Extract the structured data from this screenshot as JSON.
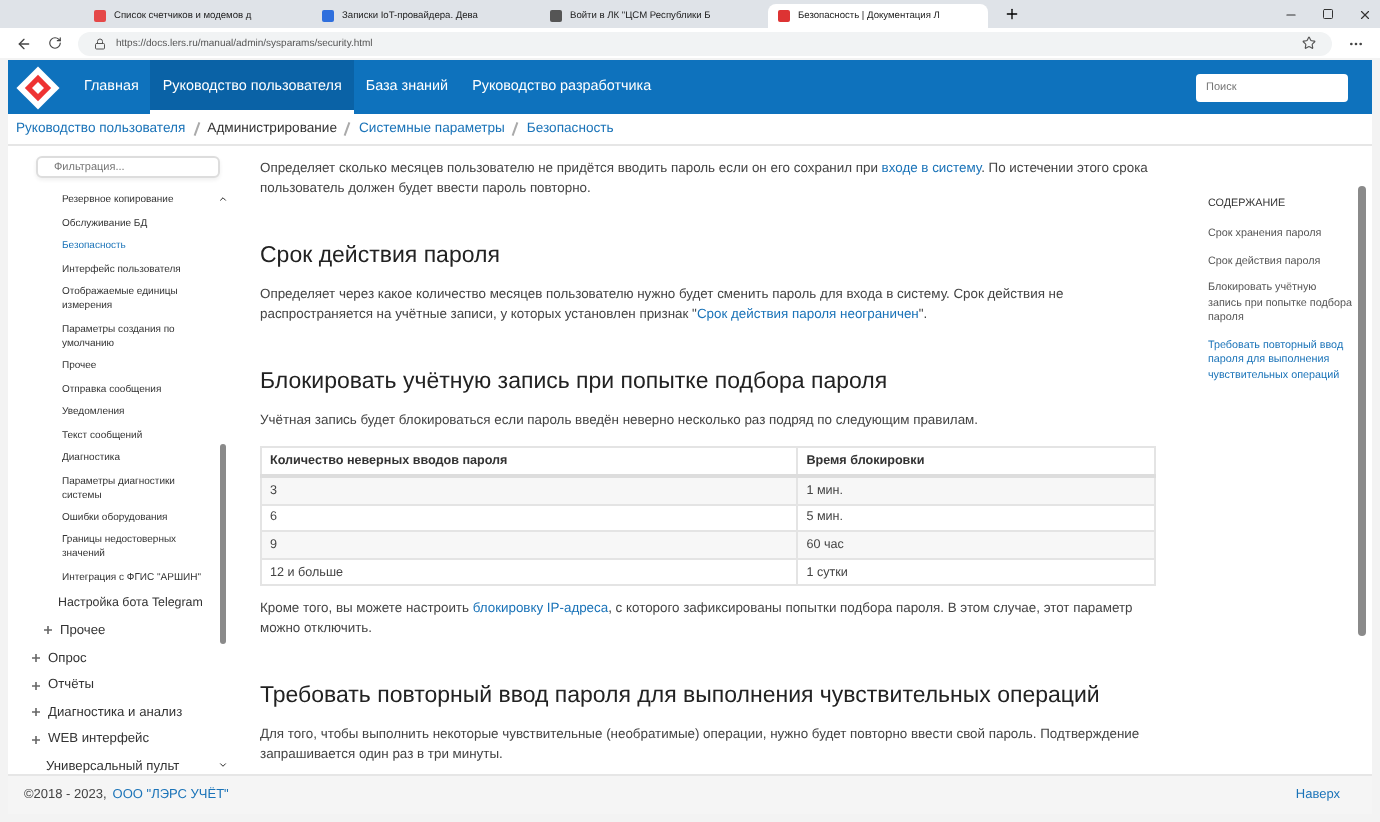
{
  "browser": {
    "tabs": [
      {
        "title": "Список счетчиков и модемов д",
        "selected": false
      },
      {
        "title": "Записки IoT-провайдера. Дева",
        "selected": false
      },
      {
        "title": "Войти в ЛК \"ЦСМ Республики Б",
        "selected": false
      },
      {
        "title": "Безопасность | Документация Л",
        "selected": true
      }
    ],
    "url": "https://docs.lers.ru/manual/admin/sysparams/security.html"
  },
  "site_nav": {
    "items": [
      {
        "label": "Главная",
        "selected": false
      },
      {
        "label": "Руководство пользователя",
        "selected": true
      },
      {
        "label": "База знаний",
        "selected": false
      },
      {
        "label": "Руководство разработчика",
        "selected": false
      }
    ],
    "search": {
      "placeholder": "Поиск"
    }
  },
  "breadcrumb": [
    {
      "label": "Руководство пользователя",
      "link": true
    },
    {
      "label": "Администрирование",
      "link": false
    },
    {
      "label": "Системные параметры",
      "link": true
    },
    {
      "label": "Безопасность",
      "link": true
    }
  ],
  "sidebar": {
    "filter": {
      "placeholder": "Фильтрация..."
    },
    "items": [
      {
        "label": "Резервное копирование",
        "kind": "page",
        "selected": false
      },
      {
        "label": "Обслуживание БД",
        "kind": "page",
        "selected": false
      },
      {
        "label": "Безопасность",
        "kind": "page",
        "selected": true
      },
      {
        "label": "Интерфейс пользователя",
        "kind": "page",
        "selected": false
      },
      {
        "label": "Отображаемые единицы измерения",
        "kind": "page",
        "selected": false
      },
      {
        "label": "Параметры создания по умолчанию",
        "kind": "page",
        "selected": false
      },
      {
        "label": "Прочее",
        "kind": "page",
        "selected": false
      },
      {
        "label": "Отправка сообщения",
        "kind": "page",
        "selected": false
      },
      {
        "label": "Уведомления",
        "kind": "page",
        "selected": false
      },
      {
        "label": "Текст сообщений",
        "kind": "page",
        "selected": false
      },
      {
        "label": "Диагностика",
        "kind": "page",
        "selected": false
      },
      {
        "label": "Параметры диагностики системы",
        "kind": "page",
        "selected": false
      },
      {
        "label": "Ошибки оборудования",
        "kind": "page",
        "selected": false
      },
      {
        "label": "Границы недостоверных значений",
        "kind": "page",
        "selected": false
      },
      {
        "label": "Интеграция с ФГИС \"АРШИН\"",
        "kind": "page",
        "selected": false
      },
      {
        "label": "Настройка бота Telegram",
        "kind": "topic",
        "selected": false
      },
      {
        "label": "Прочее",
        "kind": "group",
        "selected": false
      },
      {
        "label": "Опрос",
        "kind": "section",
        "selected": false
      },
      {
        "label": "Отчёты",
        "kind": "section",
        "selected": false
      },
      {
        "label": "Диагностика и анализ",
        "kind": "section",
        "selected": false
      },
      {
        "label": "WEB интерфейс",
        "kind": "section",
        "selected": false
      },
      {
        "label": "Универсальный пульт",
        "kind": "leaf",
        "selected": false
      }
    ]
  },
  "content": [
    {
      "kind": "paragraph",
      "parts": [
        {
          "text": "Определяет сколько месяцев пользователю не придётся вводить пароль если он его сохранил при ",
          "link": false
        },
        {
          "text": "входе в систему",
          "link": true
        },
        {
          "text": ". По истечении этого срока пользователь должен будет ввести пароль повторно.",
          "link": false
        }
      ]
    },
    {
      "kind": "heading",
      "text": "Срок действия пароля"
    },
    {
      "kind": "paragraph",
      "parts": [
        {
          "text": "Определяет через какое количество месяцев пользователю нужно будет сменить пароль для входа в систему. Срок действия не распространяется на учётные записи, у которых установлен признак \"",
          "link": false
        },
        {
          "text": "Срок действия пароля неограничен",
          "link": true
        },
        {
          "text": "\".",
          "link": false
        }
      ]
    },
    {
      "kind": "heading",
      "text": "Блокировать учётную запись при попытке подбора пароля"
    },
    {
      "kind": "paragraph",
      "parts": [
        {
          "text": "Учётная запись будет блокироваться если пароль введён неверно несколько раз подряд по следующим правилам.",
          "link": false
        }
      ]
    },
    {
      "kind": "table",
      "columns": [
        "Количество неверных вводов пароля",
        "Время блокировки"
      ],
      "rows": [
        [
          "3",
          "1 мин."
        ],
        [
          "6",
          "5 мин."
        ],
        [
          "9",
          "60 час"
        ],
        [
          "12 и больше",
          "1 сутки"
        ]
      ]
    },
    {
      "kind": "paragraph",
      "parts": [
        {
          "text": "Кроме того, вы можете настроить ",
          "link": false
        },
        {
          "text": "блокировку IP-адреса",
          "link": true
        },
        {
          "text": ", с которого зафиксированы попытки подбора пароля. В этом случае, этот параметр можно отключить.",
          "link": false
        }
      ]
    },
    {
      "kind": "heading",
      "text": "Требовать повторный ввод пароля для выполнения чувствительных операций"
    },
    {
      "kind": "paragraph",
      "parts": [
        {
          "text": "Для того, чтобы выполнить некоторые чувствительные (необратимые) операции, нужно будет повторно ввести свой пароль. Подтверждение запрашивается один раз в три минуты.",
          "link": false
        }
      ]
    }
  ],
  "toc": {
    "title": "СОДЕРЖАНИЕ",
    "items": [
      {
        "label": "Срок хранения пароля",
        "selected": false
      },
      {
        "label": "Срок действия пароля",
        "selected": false
      },
      {
        "label": "Блокировать учётную запись при попытке подбора пароля",
        "selected": false
      },
      {
        "label": "Требовать повторный ввод пароля для выполнения чувствительных операций",
        "selected": true
      }
    ]
  },
  "footer": {
    "copyright": "©2018 - 2023, ",
    "company": "ООО \"ЛЭРС УЧЁТ\"",
    "top_link": "Наверх"
  }
}
